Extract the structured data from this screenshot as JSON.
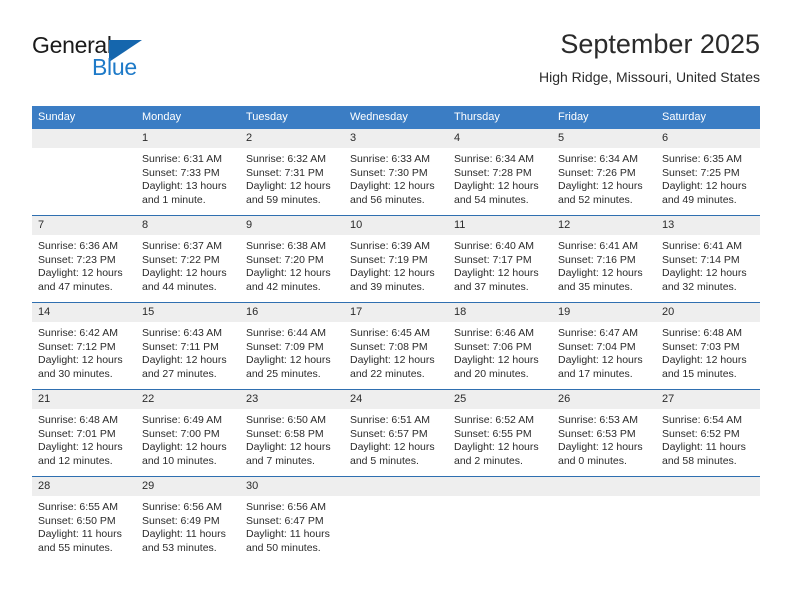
{
  "brand": {
    "name_line1": "General",
    "name_line2": "Blue",
    "icon": "triangle-logo-icon",
    "colors": {
      "blue": "#1e7ac8",
      "dark_blue": "#1566ad",
      "text": "#1a1a1a"
    }
  },
  "header": {
    "title": "September 2025",
    "location": "High Ridge, Missouri, United States"
  },
  "calendar": {
    "header_background": "#3b7dc4",
    "row_divider_color": "#2f6fb0",
    "daynum_band_color": "#eeeeee",
    "weekday_headers": [
      "Sunday",
      "Monday",
      "Tuesday",
      "Wednesday",
      "Thursday",
      "Friday",
      "Saturday"
    ],
    "weeks": [
      [
        {
          "day": "",
          "empty": true,
          "sunrise": "",
          "sunset": "",
          "daylight_line1": "",
          "daylight_line2": ""
        },
        {
          "day": "1",
          "sunrise": "Sunrise: 6:31 AM",
          "sunset": "Sunset: 7:33 PM",
          "daylight_line1": "Daylight: 13 hours",
          "daylight_line2": "and 1 minute."
        },
        {
          "day": "2",
          "sunrise": "Sunrise: 6:32 AM",
          "sunset": "Sunset: 7:31 PM",
          "daylight_line1": "Daylight: 12 hours",
          "daylight_line2": "and 59 minutes."
        },
        {
          "day": "3",
          "sunrise": "Sunrise: 6:33 AM",
          "sunset": "Sunset: 7:30 PM",
          "daylight_line1": "Daylight: 12 hours",
          "daylight_line2": "and 56 minutes."
        },
        {
          "day": "4",
          "sunrise": "Sunrise: 6:34 AM",
          "sunset": "Sunset: 7:28 PM",
          "daylight_line1": "Daylight: 12 hours",
          "daylight_line2": "and 54 minutes."
        },
        {
          "day": "5",
          "sunrise": "Sunrise: 6:34 AM",
          "sunset": "Sunset: 7:26 PM",
          "daylight_line1": "Daylight: 12 hours",
          "daylight_line2": "and 52 minutes."
        },
        {
          "day": "6",
          "sunrise": "Sunrise: 6:35 AM",
          "sunset": "Sunset: 7:25 PM",
          "daylight_line1": "Daylight: 12 hours",
          "daylight_line2": "and 49 minutes."
        }
      ],
      [
        {
          "day": "7",
          "sunrise": "Sunrise: 6:36 AM",
          "sunset": "Sunset: 7:23 PM",
          "daylight_line1": "Daylight: 12 hours",
          "daylight_line2": "and 47 minutes."
        },
        {
          "day": "8",
          "sunrise": "Sunrise: 6:37 AM",
          "sunset": "Sunset: 7:22 PM",
          "daylight_line1": "Daylight: 12 hours",
          "daylight_line2": "and 44 minutes."
        },
        {
          "day": "9",
          "sunrise": "Sunrise: 6:38 AM",
          "sunset": "Sunset: 7:20 PM",
          "daylight_line1": "Daylight: 12 hours",
          "daylight_line2": "and 42 minutes."
        },
        {
          "day": "10",
          "sunrise": "Sunrise: 6:39 AM",
          "sunset": "Sunset: 7:19 PM",
          "daylight_line1": "Daylight: 12 hours",
          "daylight_line2": "and 39 minutes."
        },
        {
          "day": "11",
          "sunrise": "Sunrise: 6:40 AM",
          "sunset": "Sunset: 7:17 PM",
          "daylight_line1": "Daylight: 12 hours",
          "daylight_line2": "and 37 minutes."
        },
        {
          "day": "12",
          "sunrise": "Sunrise: 6:41 AM",
          "sunset": "Sunset: 7:16 PM",
          "daylight_line1": "Daylight: 12 hours",
          "daylight_line2": "and 35 minutes."
        },
        {
          "day": "13",
          "sunrise": "Sunrise: 6:41 AM",
          "sunset": "Sunset: 7:14 PM",
          "daylight_line1": "Daylight: 12 hours",
          "daylight_line2": "and 32 minutes."
        }
      ],
      [
        {
          "day": "14",
          "sunrise": "Sunrise: 6:42 AM",
          "sunset": "Sunset: 7:12 PM",
          "daylight_line1": "Daylight: 12 hours",
          "daylight_line2": "and 30 minutes."
        },
        {
          "day": "15",
          "sunrise": "Sunrise: 6:43 AM",
          "sunset": "Sunset: 7:11 PM",
          "daylight_line1": "Daylight: 12 hours",
          "daylight_line2": "and 27 minutes."
        },
        {
          "day": "16",
          "sunrise": "Sunrise: 6:44 AM",
          "sunset": "Sunset: 7:09 PM",
          "daylight_line1": "Daylight: 12 hours",
          "daylight_line2": "and 25 minutes."
        },
        {
          "day": "17",
          "sunrise": "Sunrise: 6:45 AM",
          "sunset": "Sunset: 7:08 PM",
          "daylight_line1": "Daylight: 12 hours",
          "daylight_line2": "and 22 minutes."
        },
        {
          "day": "18",
          "sunrise": "Sunrise: 6:46 AM",
          "sunset": "Sunset: 7:06 PM",
          "daylight_line1": "Daylight: 12 hours",
          "daylight_line2": "and 20 minutes."
        },
        {
          "day": "19",
          "sunrise": "Sunrise: 6:47 AM",
          "sunset": "Sunset: 7:04 PM",
          "daylight_line1": "Daylight: 12 hours",
          "daylight_line2": "and 17 minutes."
        },
        {
          "day": "20",
          "sunrise": "Sunrise: 6:48 AM",
          "sunset": "Sunset: 7:03 PM",
          "daylight_line1": "Daylight: 12 hours",
          "daylight_line2": "and 15 minutes."
        }
      ],
      [
        {
          "day": "21",
          "sunrise": "Sunrise: 6:48 AM",
          "sunset": "Sunset: 7:01 PM",
          "daylight_line1": "Daylight: 12 hours",
          "daylight_line2": "and 12 minutes."
        },
        {
          "day": "22",
          "sunrise": "Sunrise: 6:49 AM",
          "sunset": "Sunset: 7:00 PM",
          "daylight_line1": "Daylight: 12 hours",
          "daylight_line2": "and 10 minutes."
        },
        {
          "day": "23",
          "sunrise": "Sunrise: 6:50 AM",
          "sunset": "Sunset: 6:58 PM",
          "daylight_line1": "Daylight: 12 hours",
          "daylight_line2": "and 7 minutes."
        },
        {
          "day": "24",
          "sunrise": "Sunrise: 6:51 AM",
          "sunset": "Sunset: 6:57 PM",
          "daylight_line1": "Daylight: 12 hours",
          "daylight_line2": "and 5 minutes."
        },
        {
          "day": "25",
          "sunrise": "Sunrise: 6:52 AM",
          "sunset": "Sunset: 6:55 PM",
          "daylight_line1": "Daylight: 12 hours",
          "daylight_line2": "and 2 minutes."
        },
        {
          "day": "26",
          "sunrise": "Sunrise: 6:53 AM",
          "sunset": "Sunset: 6:53 PM",
          "daylight_line1": "Daylight: 12 hours",
          "daylight_line2": "and 0 minutes."
        },
        {
          "day": "27",
          "sunrise": "Sunrise: 6:54 AM",
          "sunset": "Sunset: 6:52 PM",
          "daylight_line1": "Daylight: 11 hours",
          "daylight_line2": "and 58 minutes."
        }
      ],
      [
        {
          "day": "28",
          "sunrise": "Sunrise: 6:55 AM",
          "sunset": "Sunset: 6:50 PM",
          "daylight_line1": "Daylight: 11 hours",
          "daylight_line2": "and 55 minutes."
        },
        {
          "day": "29",
          "sunrise": "Sunrise: 6:56 AM",
          "sunset": "Sunset: 6:49 PM",
          "daylight_line1": "Daylight: 11 hours",
          "daylight_line2": "and 53 minutes."
        },
        {
          "day": "30",
          "sunrise": "Sunrise: 6:56 AM",
          "sunset": "Sunset: 6:47 PM",
          "daylight_line1": "Daylight: 11 hours",
          "daylight_line2": "and 50 minutes."
        },
        {
          "day": "",
          "empty": true,
          "sunrise": "",
          "sunset": "",
          "daylight_line1": "",
          "daylight_line2": ""
        },
        {
          "day": "",
          "empty": true,
          "sunrise": "",
          "sunset": "",
          "daylight_line1": "",
          "daylight_line2": ""
        },
        {
          "day": "",
          "empty": true,
          "sunrise": "",
          "sunset": "",
          "daylight_line1": "",
          "daylight_line2": ""
        },
        {
          "day": "",
          "empty": true,
          "sunrise": "",
          "sunset": "",
          "daylight_line1": "",
          "daylight_line2": ""
        }
      ]
    ]
  }
}
